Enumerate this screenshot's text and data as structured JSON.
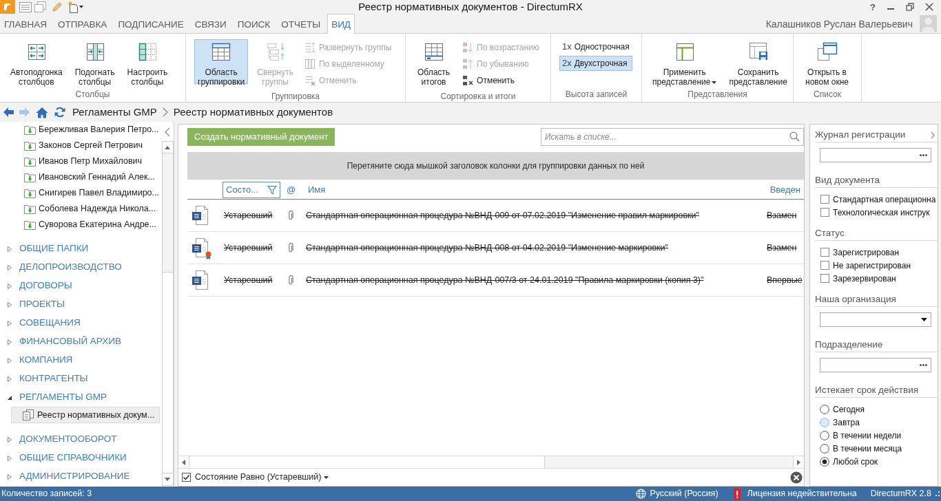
{
  "window": {
    "title": "Реестр нормативных документов - DirectumRX",
    "help": "?"
  },
  "ribbon_tabs": [
    {
      "label": "ГЛАВНАЯ",
      "selected": false
    },
    {
      "label": "ОТПРАВКА",
      "selected": false
    },
    {
      "label": "ПОДПИСАНИЕ",
      "selected": false
    },
    {
      "label": "СВЯЗИ",
      "selected": false
    },
    {
      "label": "ПОИСК",
      "selected": false
    },
    {
      "label": "ОТЧЕТЫ",
      "selected": false
    },
    {
      "label": "ВИД",
      "selected": true
    }
  ],
  "user": {
    "name": "Калашников Руслан Валерьевич"
  },
  "ribbon_groups": [
    {
      "label": "Столбцы",
      "buttons": [
        {
          "kind": "large",
          "label": "Автоподгонка\nстолбцов",
          "selected": false,
          "disabled": false
        },
        {
          "kind": "large",
          "label": "Подогнать\nстолбцы",
          "selected": false,
          "disabled": false
        },
        {
          "kind": "large",
          "label": "Настроить\nстолбцы",
          "selected": false,
          "disabled": false
        }
      ]
    },
    {
      "label": "Группировка",
      "buttons": [
        {
          "kind": "large",
          "label": "Область\nгруппировки",
          "selected": true,
          "disabled": false
        },
        {
          "kind": "large",
          "label": "Свернуть\nгруппы",
          "selected": false,
          "disabled": true
        },
        {
          "kind": "small",
          "label": "Развернуть группы",
          "selected": false,
          "disabled": true
        },
        {
          "kind": "small",
          "label": "По выделенному",
          "selected": false,
          "disabled": true
        },
        {
          "kind": "small",
          "label": "Отменить",
          "selected": false,
          "disabled": true
        }
      ]
    },
    {
      "label": "Сортировка и итоги",
      "buttons": [
        {
          "kind": "large",
          "label": "Область\nитогов",
          "selected": false,
          "disabled": false
        },
        {
          "kind": "small",
          "label": "По возрастанию",
          "selected": false,
          "disabled": true
        },
        {
          "kind": "small",
          "label": "По убыванию",
          "selected": false,
          "disabled": true
        },
        {
          "kind": "small",
          "label": "Отменить",
          "selected": false,
          "disabled": false
        }
      ]
    },
    {
      "label": "Высота записей",
      "buttons": [
        {
          "kind": "toggle",
          "glyph": "1x",
          "label": "Однострочная",
          "selected": false,
          "disabled": false
        },
        {
          "kind": "toggle",
          "glyph": "2x",
          "label": "Двухстрочная",
          "selected": true,
          "disabled": false
        }
      ]
    },
    {
      "label": "Представления",
      "buttons": [
        {
          "kind": "large",
          "label": "Применить\nпредставление",
          "menu": true,
          "selected": false,
          "disabled": false
        },
        {
          "kind": "large",
          "label": "Сохранить\nпредставление",
          "selected": false,
          "disabled": false
        }
      ]
    },
    {
      "label": "Список",
      "buttons": [
        {
          "kind": "large",
          "label": "Открыть в\nновом окне",
          "selected": false,
          "disabled": false
        }
      ]
    }
  ],
  "navigation": {
    "buttons": [
      {
        "kind": "back",
        "disabled": false
      },
      {
        "kind": "forward",
        "disabled": true
      },
      {
        "kind": "home",
        "disabled": false
      },
      {
        "kind": "refresh",
        "disabled": false
      }
    ],
    "breadcrumb": [
      "Регламенты GMP",
      "Реестр нормативных документов"
    ]
  },
  "sidebar": {
    "scrolled_children": [
      {
        "label": "Бережливая Валерия Петро...",
        "selected": false
      },
      {
        "label": "Законов Сергей Петрович",
        "selected": false
      },
      {
        "label": "Иванов Петр Михайлович",
        "selected": false
      },
      {
        "label": "Ивановский Геннадий Алек...",
        "selected": false
      },
      {
        "label": "Снигирев Павел Владимиро...",
        "selected": false
      },
      {
        "label": "Соболева Надежда Никола...",
        "selected": false
      },
      {
        "label": "Суворова Екатерина Андре...",
        "selected": false
      }
    ],
    "nodes": [
      {
        "label": "ОБЩИЕ ПАПКИ",
        "expanded": false,
        "selected": false
      },
      {
        "label": "ДЕЛОПРОИЗВОДСТВО",
        "expanded": false,
        "selected": false
      },
      {
        "label": "ДОГОВОРЫ",
        "expanded": false,
        "selected": false
      },
      {
        "label": "ПРОЕКТЫ",
        "expanded": false,
        "selected": false
      },
      {
        "label": "СОВЕЩАНИЯ",
        "expanded": false,
        "selected": false
      },
      {
        "label": "ФИНАНСОВЫЙ АРХИВ",
        "expanded": false,
        "selected": false
      },
      {
        "label": "КОМПАНИЯ",
        "expanded": false,
        "selected": false
      },
      {
        "label": "КОНТРАГЕНТЫ",
        "expanded": false,
        "selected": false
      },
      {
        "label": "РЕГЛАМЕНТЫ GMP",
        "expanded": true,
        "selected": false,
        "children": [
          {
            "label": "Реестр нормативных докум...",
            "selected": true
          }
        ]
      },
      {
        "label": "ДОКУМЕНТООБОРОТ",
        "expanded": false,
        "selected": false
      },
      {
        "label": "ОБЩИЕ СПРАВОЧНИКИ",
        "expanded": false,
        "selected": false
      },
      {
        "label": "АДМИНИСТРИРОВАНИЕ",
        "expanded": false,
        "selected": false
      }
    ]
  },
  "list": {
    "create_button": "Создать нормативный документ",
    "search": {
      "placeholder": "Искать в списке..."
    },
    "group_hint": "Перетяните сюда мышкой заголовок колонки для группировки данных по ней",
    "columns": [
      {
        "label": "Состо...",
        "filtered": true
      },
      {
        "label": "@",
        "filtered": false
      },
      {
        "label": "Имя",
        "filtered": false
      },
      {
        "label": "Введен",
        "filtered": false
      }
    ],
    "rows": [
      {
        "status": "Устаревший",
        "name": "Стандартная операционная процедура №ВНД-009 от 07.02.2019 \"Изменение правил маркировки\"",
        "introduced": "Взамен",
        "struck": true,
        "attachment": true,
        "seal": false
      },
      {
        "status": "Устаревший",
        "name": "Стандартная операционная процедура №ВНД-008 от 04.02.2019 \"Изменение маркировки\"",
        "introduced": "Взамен",
        "struck": true,
        "attachment": true,
        "seal": true
      },
      {
        "status": "Устаревший",
        "name": "Стандартная операционная процедура №ВНД-007/3 от 24.01.2019 \"Правила маркировки (копия 3)\"",
        "introduced": "Впервые",
        "struck": true,
        "attachment": true,
        "seal": false
      }
    ],
    "filter_bar": {
      "checked": true,
      "label": "Состояние Равно (Устаревший)"
    }
  },
  "filter_panel": {
    "sections": [
      {
        "kind": "lookup",
        "title": "Журнал регистрации"
      },
      {
        "kind": "checkboxes",
        "title": "Вид документа",
        "options": [
          {
            "label": "Стандартная операционна",
            "checked": false
          },
          {
            "label": "Технологическая инструк",
            "checked": false
          }
        ]
      },
      {
        "kind": "checkboxes",
        "title": "Статус",
        "options": [
          {
            "label": "Зарегистрирован",
            "checked": false
          },
          {
            "label": "Не зарегистрирован",
            "checked": false
          },
          {
            "label": "Зарезервирован",
            "checked": false
          }
        ]
      },
      {
        "kind": "dropdown",
        "title": "Наша организация"
      },
      {
        "kind": "lookup",
        "title": "Подразделение"
      },
      {
        "kind": "radios",
        "title": "Истекает срок действия",
        "options": [
          {
            "label": "Сегодня",
            "selected": false,
            "hovered": false
          },
          {
            "label": "Завтра",
            "selected": false,
            "hovered": true
          },
          {
            "label": "В течении недели",
            "selected": false,
            "hovered": false
          },
          {
            "label": "В течении месяца",
            "selected": false,
            "hovered": false
          },
          {
            "label": "Любой срок",
            "selected": true,
            "hovered": false
          }
        ]
      }
    ]
  },
  "status_bar": {
    "record_count": "Количество записей: 3",
    "language": "Русский (Россия)",
    "license": "Лицензия недействительна",
    "version": "DirectumRX 2.8"
  }
}
